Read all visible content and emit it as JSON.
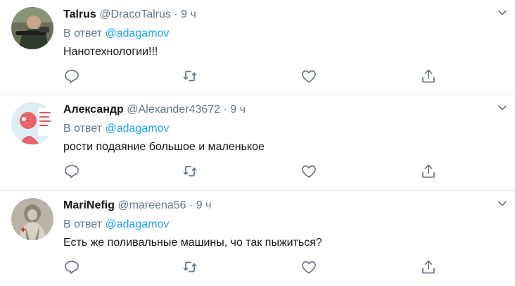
{
  "tweets": [
    {
      "name": "Talrus",
      "handle": "@DracoTalrus",
      "dot": "·",
      "time": "9 ч",
      "reply_prefix": "В ответ ",
      "reply_to": "@adagamov",
      "text": "Нанотехнологии!!!"
    },
    {
      "name": "Александр",
      "handle": "@Alexander43672",
      "dot": "·",
      "time": "9 ч",
      "reply_prefix": "В ответ ",
      "reply_to": "@adagamov",
      "text": "рости подаяние большое и маленькое"
    },
    {
      "name": "MariNefig",
      "handle": "@mareena56",
      "dot": "·",
      "time": "9 ч",
      "reply_prefix": "В ответ ",
      "reply_to": "@adagamov",
      "text": "Есть же поливальные машины, чо так пыжиться?"
    }
  ],
  "icons": {
    "more": "chevron-down-icon",
    "reply": "reply-icon",
    "retweet": "retweet-icon",
    "like": "heart-icon",
    "share": "share-icon"
  },
  "colors": {
    "link": "#1da1f2",
    "secondary": "#657786",
    "divider": "#e6ecf0"
  }
}
